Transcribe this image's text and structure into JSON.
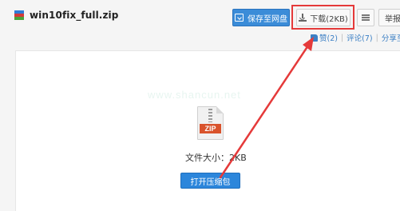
{
  "file": {
    "name": "win10fix_full.zip"
  },
  "toolbar": {
    "save_label": "保存至网盘",
    "download_label": "下载(2KB)",
    "report_label": "举报"
  },
  "actions": {
    "like_label": "赞(2)",
    "comment_label": "评论(7)",
    "share_label": "分享至"
  },
  "preview": {
    "file_type_badge": "ZIP",
    "size_label": "文件大小：",
    "size_value": "2KB",
    "open_button_label": "打开压缩包"
  },
  "colors": {
    "accent_blue": "#2c86db",
    "annotation_red": "#e53a3a",
    "zip_orange": "#d9532c"
  }
}
